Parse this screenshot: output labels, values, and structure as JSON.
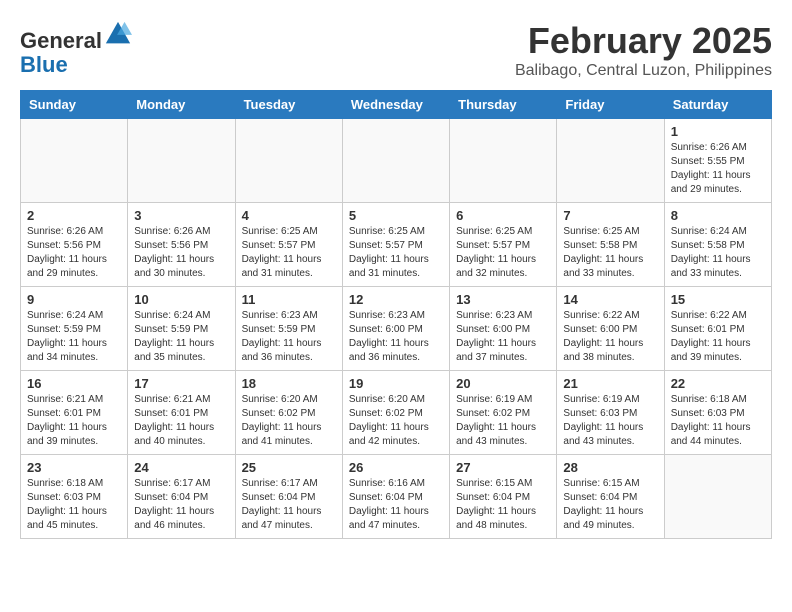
{
  "header": {
    "logo_general": "General",
    "logo_blue": "Blue",
    "month": "February 2025",
    "location": "Balibago, Central Luzon, Philippines"
  },
  "days_of_week": [
    "Sunday",
    "Monday",
    "Tuesday",
    "Wednesday",
    "Thursday",
    "Friday",
    "Saturday"
  ],
  "weeks": [
    [
      {
        "day": "",
        "info": ""
      },
      {
        "day": "",
        "info": ""
      },
      {
        "day": "",
        "info": ""
      },
      {
        "day": "",
        "info": ""
      },
      {
        "day": "",
        "info": ""
      },
      {
        "day": "",
        "info": ""
      },
      {
        "day": "1",
        "info": "Sunrise: 6:26 AM\nSunset: 5:55 PM\nDaylight: 11 hours\nand 29 minutes."
      }
    ],
    [
      {
        "day": "2",
        "info": "Sunrise: 6:26 AM\nSunset: 5:56 PM\nDaylight: 11 hours\nand 29 minutes."
      },
      {
        "day": "3",
        "info": "Sunrise: 6:26 AM\nSunset: 5:56 PM\nDaylight: 11 hours\nand 30 minutes."
      },
      {
        "day": "4",
        "info": "Sunrise: 6:25 AM\nSunset: 5:57 PM\nDaylight: 11 hours\nand 31 minutes."
      },
      {
        "day": "5",
        "info": "Sunrise: 6:25 AM\nSunset: 5:57 PM\nDaylight: 11 hours\nand 31 minutes."
      },
      {
        "day": "6",
        "info": "Sunrise: 6:25 AM\nSunset: 5:57 PM\nDaylight: 11 hours\nand 32 minutes."
      },
      {
        "day": "7",
        "info": "Sunrise: 6:25 AM\nSunset: 5:58 PM\nDaylight: 11 hours\nand 33 minutes."
      },
      {
        "day": "8",
        "info": "Sunrise: 6:24 AM\nSunset: 5:58 PM\nDaylight: 11 hours\nand 33 minutes."
      }
    ],
    [
      {
        "day": "9",
        "info": "Sunrise: 6:24 AM\nSunset: 5:59 PM\nDaylight: 11 hours\nand 34 minutes."
      },
      {
        "day": "10",
        "info": "Sunrise: 6:24 AM\nSunset: 5:59 PM\nDaylight: 11 hours\nand 35 minutes."
      },
      {
        "day": "11",
        "info": "Sunrise: 6:23 AM\nSunset: 5:59 PM\nDaylight: 11 hours\nand 36 minutes."
      },
      {
        "day": "12",
        "info": "Sunrise: 6:23 AM\nSunset: 6:00 PM\nDaylight: 11 hours\nand 36 minutes."
      },
      {
        "day": "13",
        "info": "Sunrise: 6:23 AM\nSunset: 6:00 PM\nDaylight: 11 hours\nand 37 minutes."
      },
      {
        "day": "14",
        "info": "Sunrise: 6:22 AM\nSunset: 6:00 PM\nDaylight: 11 hours\nand 38 minutes."
      },
      {
        "day": "15",
        "info": "Sunrise: 6:22 AM\nSunset: 6:01 PM\nDaylight: 11 hours\nand 39 minutes."
      }
    ],
    [
      {
        "day": "16",
        "info": "Sunrise: 6:21 AM\nSunset: 6:01 PM\nDaylight: 11 hours\nand 39 minutes."
      },
      {
        "day": "17",
        "info": "Sunrise: 6:21 AM\nSunset: 6:01 PM\nDaylight: 11 hours\nand 40 minutes."
      },
      {
        "day": "18",
        "info": "Sunrise: 6:20 AM\nSunset: 6:02 PM\nDaylight: 11 hours\nand 41 minutes."
      },
      {
        "day": "19",
        "info": "Sunrise: 6:20 AM\nSunset: 6:02 PM\nDaylight: 11 hours\nand 42 minutes."
      },
      {
        "day": "20",
        "info": "Sunrise: 6:19 AM\nSunset: 6:02 PM\nDaylight: 11 hours\nand 43 minutes."
      },
      {
        "day": "21",
        "info": "Sunrise: 6:19 AM\nSunset: 6:03 PM\nDaylight: 11 hours\nand 43 minutes."
      },
      {
        "day": "22",
        "info": "Sunrise: 6:18 AM\nSunset: 6:03 PM\nDaylight: 11 hours\nand 44 minutes."
      }
    ],
    [
      {
        "day": "23",
        "info": "Sunrise: 6:18 AM\nSunset: 6:03 PM\nDaylight: 11 hours\nand 45 minutes."
      },
      {
        "day": "24",
        "info": "Sunrise: 6:17 AM\nSunset: 6:04 PM\nDaylight: 11 hours\nand 46 minutes."
      },
      {
        "day": "25",
        "info": "Sunrise: 6:17 AM\nSunset: 6:04 PM\nDaylight: 11 hours\nand 47 minutes."
      },
      {
        "day": "26",
        "info": "Sunrise: 6:16 AM\nSunset: 6:04 PM\nDaylight: 11 hours\nand 47 minutes."
      },
      {
        "day": "27",
        "info": "Sunrise: 6:15 AM\nSunset: 6:04 PM\nDaylight: 11 hours\nand 48 minutes."
      },
      {
        "day": "28",
        "info": "Sunrise: 6:15 AM\nSunset: 6:04 PM\nDaylight: 11 hours\nand 49 minutes."
      },
      {
        "day": "",
        "info": ""
      }
    ]
  ]
}
